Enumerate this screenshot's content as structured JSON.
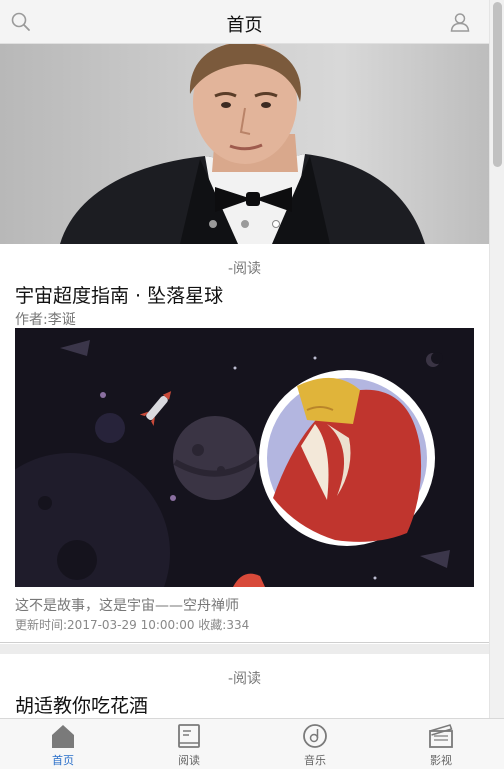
{
  "header": {
    "title": "首页",
    "search_icon": "search-icon",
    "user_icon": "user-icon"
  },
  "banner": {
    "slide_count": 3,
    "active_index": 2
  },
  "articles": [
    {
      "category": "-阅读",
      "title": "宇宙超度指南 · 坠落星球",
      "author": "作者:李诞",
      "summary": "这不是故事，这是宇宙——空舟禅师",
      "meta": "更新时间:2017-03-29 10:00:00 收藏:334"
    },
    {
      "category": "-阅读",
      "title": "胡适教你吃花酒"
    }
  ],
  "tabs": [
    {
      "label": "首页",
      "icon": "home-icon",
      "active": true
    },
    {
      "label": "阅读",
      "icon": "book-icon",
      "active": false
    },
    {
      "label": "音乐",
      "icon": "music-disc-icon",
      "active": false
    },
    {
      "label": "影视",
      "icon": "film-icon",
      "active": false
    }
  ],
  "colors": {
    "accent": "#2a6fc9",
    "cover_background": "#14121c",
    "divider": "#ececec"
  }
}
